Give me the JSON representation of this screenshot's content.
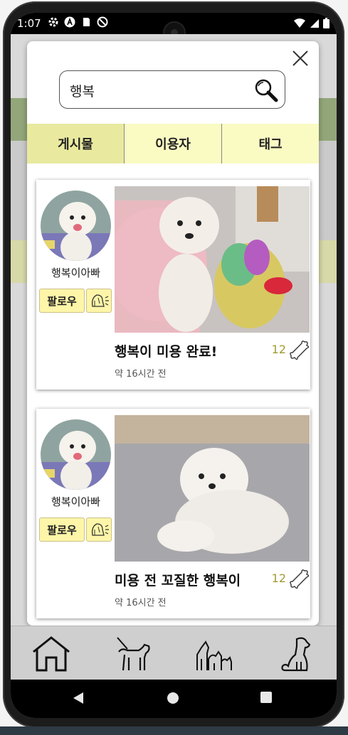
{
  "status": {
    "time": "1:07"
  },
  "search": {
    "value": "행복",
    "placeholder": ""
  },
  "tabs": [
    {
      "label": "게시물",
      "active": true
    },
    {
      "label": "이용자",
      "active": false
    },
    {
      "label": "태그",
      "active": false
    }
  ],
  "posts": [
    {
      "user": "행복이아빠",
      "follow_label": "팔로우",
      "title": "행복이 미용 완료!",
      "likes": "12",
      "time": "약 16시간 전"
    },
    {
      "user": "행복이아빠",
      "follow_label": "팔로우",
      "title": "미용 전 꼬질한 행복이",
      "likes": "12",
      "time": "약 16시간 전"
    }
  ],
  "icons": {
    "close": "close-icon",
    "search": "search-icon",
    "notify": "dog-bell-icon",
    "like": "bone-icon",
    "nav": [
      "home-icon",
      "dog-walk-icon",
      "dog-group-icon",
      "dog-sit-icon"
    ]
  },
  "colors": {
    "tab_bg": "#fafac3",
    "tab_active": "#e9ea9f",
    "follow_bg": "#fdf5a8",
    "likes_text": "#a19a30"
  }
}
